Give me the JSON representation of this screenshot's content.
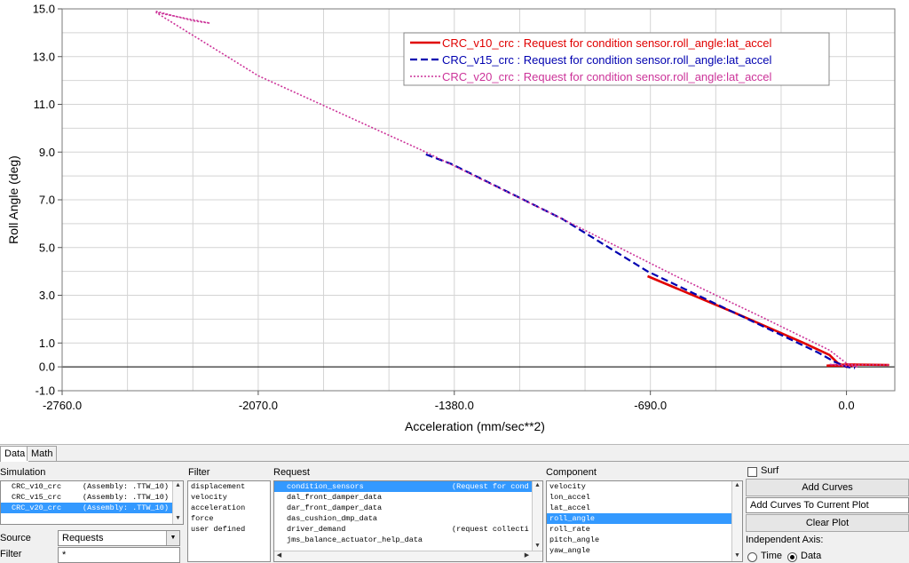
{
  "chart_data": {
    "type": "line",
    "xlabel": "Acceleration (mm/sec**2)",
    "ylabel": "Roll Angle (deg)",
    "xlim": [
      -2760,
      170
    ],
    "ylim": [
      -1.0,
      15.0
    ],
    "xticks": [
      -2760.0,
      -2070.0,
      -1380.0,
      -690.0,
      0.0
    ],
    "xtick_labels": [
      "-2760.0",
      "-2070.0",
      "-1380.0",
      "-690.0",
      "0.0"
    ],
    "yticks": [
      -1.0,
      0.0,
      1.0,
      3.0,
      5.0,
      7.0,
      9.0,
      11.0,
      13.0,
      15.0
    ],
    "ytick_labels": [
      "-1.0",
      "0.0",
      "1.0",
      "3.0",
      "5.0",
      "7.0",
      "9.0",
      "11.0",
      "13.0",
      "15.0"
    ],
    "grid": true,
    "legend_position": "top-right",
    "series": [
      {
        "name": "CRC_v10_crc : Request for condition sensor.roll_angle:lat_accel",
        "color": "#e00000",
        "style": "solid",
        "x": [
          -700,
          -400,
          -150,
          -60,
          -30,
          0,
          30,
          0,
          -70,
          0,
          150
        ],
        "y": [
          3.8,
          2.3,
          1.0,
          0.5,
          0.15,
          0.0,
          0.1,
          0.05,
          0.05,
          0.1,
          0.08
        ]
      },
      {
        "name": "CRC_v15_crc : Request for condition sensor.roll_angle:lat_accel",
        "color": "#0000b0",
        "style": "dashed",
        "x": [
          -1480,
          -1390,
          -1000,
          -700,
          -400,
          -100,
          -40,
          0,
          30
        ],
        "y": [
          8.9,
          8.5,
          6.2,
          4.0,
          2.3,
          0.6,
          0.2,
          0.0,
          -0.05
        ]
      },
      {
        "name": "CRC_v20_crc : Request for condition sensor.roll_angle:lat_accel",
        "color": "#cc3399",
        "style": "dotted",
        "x": [
          -2430,
          -2300,
          -2240,
          -2430,
          -2070,
          -1480,
          -1000,
          -600,
          -300,
          -60,
          0,
          40,
          -60,
          150
        ],
        "y": [
          14.9,
          14.5,
          14.4,
          14.85,
          12.2,
          9.0,
          6.2,
          3.8,
          2.1,
          0.7,
          0.15,
          0.0,
          0.1,
          0.08
        ]
      }
    ]
  },
  "panel": {
    "tabs": [
      "Data",
      "Math"
    ],
    "simulation_label": "Simulation",
    "simulations": [
      {
        "name": "CRC_v10_crc",
        "info": "(Assembly: .TTW_10)"
      },
      {
        "name": "CRC_v15_crc",
        "info": "(Assembly: .TTW_10)"
      },
      {
        "name": "CRC_v20_crc",
        "info": "(Assembly: .TTW_10)"
      }
    ],
    "source_label": "Source",
    "source_value": "Requests",
    "filter_input_label": "Filter",
    "filter_input_value": "*",
    "filter_label": "Filter",
    "filters": [
      "displacement",
      "velocity",
      "acceleration",
      "force",
      "user defined"
    ],
    "request_label": "Request",
    "requests": [
      {
        "name": "condition_sensors",
        "info": "(Request for cond"
      },
      {
        "name": "dal_front_damper_data",
        "info": ""
      },
      {
        "name": "dar_front_damper_data",
        "info": ""
      },
      {
        "name": "das_cushion_dmp_data",
        "info": ""
      },
      {
        "name": "driver_demand",
        "info": "(request collecti"
      },
      {
        "name": "jms_balance_actuator_help_data",
        "info": ""
      }
    ],
    "component_label": "Component",
    "components": [
      "velocity",
      "lon_accel",
      "lat_accel",
      "roll_angle",
      "roll_rate",
      "pitch_angle",
      "yaw_angle"
    ],
    "surf_label": "Surf",
    "add_curves_label": "Add Curves",
    "add_mode_value": "Add Curves To Current Plot",
    "clear_plot_label": "Clear Plot",
    "independent_axis_label": "Independent Axis:",
    "radio_time_label": "Time",
    "radio_data_label": "Data"
  }
}
